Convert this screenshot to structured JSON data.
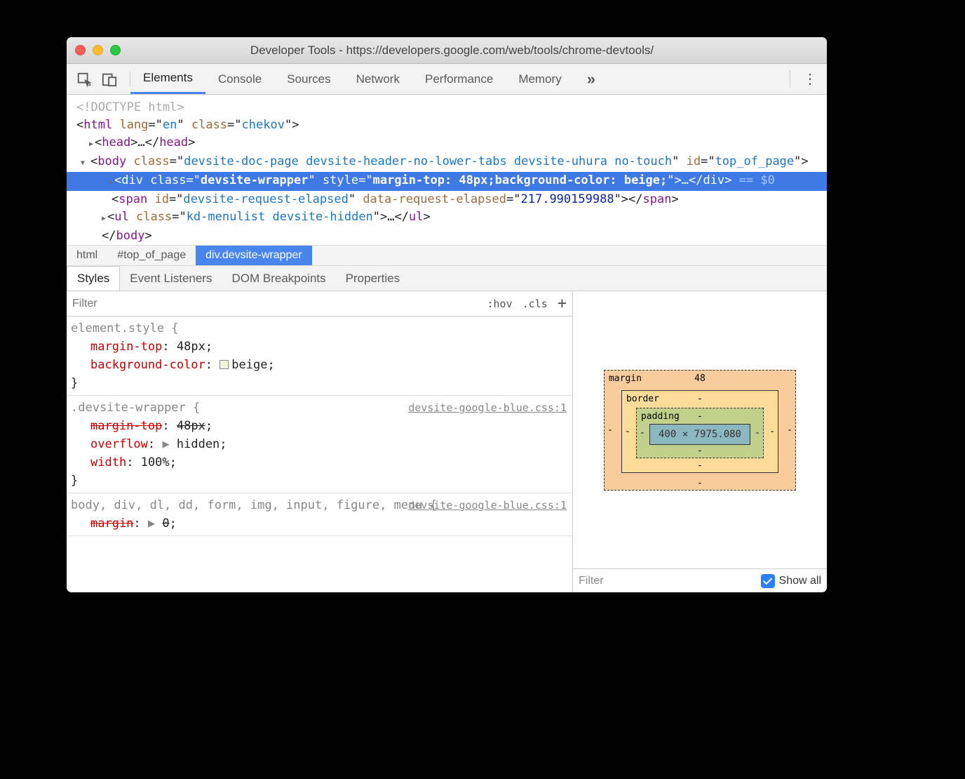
{
  "window_title": "Developer Tools - https://developers.google.com/web/tools/chrome-devtools/",
  "tabs": [
    "Elements",
    "Console",
    "Sources",
    "Network",
    "Performance",
    "Memory"
  ],
  "active_tab": "Elements",
  "dom": {
    "doctype": "<!DOCTYPE html>",
    "html_open": {
      "tag": "html",
      "lang": "en",
      "class": "chekov"
    },
    "head": {
      "tag": "head"
    },
    "body_open": {
      "tag": "body",
      "class": "devsite-doc-page devsite-header-no-lower-tabs devsite-uhura no-touch",
      "id": "top_of_page"
    },
    "selected": {
      "tag": "div",
      "class": "devsite-wrapper",
      "style": "margin-top: 48px;background-color: beige;",
      "eq": "== $0"
    },
    "span": {
      "tag": "span",
      "id": "devsite-request-elapsed",
      "attr": "data-request-elapsed",
      "attrval": "217.990159988"
    },
    "ul": {
      "tag": "ul",
      "class": "kd-menulist devsite-hidden"
    },
    "body_close": "</body>"
  },
  "breadcrumb": [
    "html",
    "#top_of_page",
    "div.devsite-wrapper"
  ],
  "subtabs": [
    "Styles",
    "Event Listeners",
    "DOM Breakpoints",
    "Properties"
  ],
  "active_subtab": "Styles",
  "filter_placeholder": "Filter",
  "hov": ":hov",
  "cls": ".cls",
  "rules": [
    {
      "selector": "element.style",
      "props": [
        {
          "k": "margin-top",
          "v": "48px"
        },
        {
          "k": "background-color",
          "v": "beige",
          "swatch": true
        }
      ]
    },
    {
      "selector": ".devsite-wrapper",
      "src": "devsite-google-blue.css:1",
      "props": [
        {
          "k": "margin-top",
          "v": "48px",
          "strike": true
        },
        {
          "k": "overflow",
          "v": "hidden",
          "tri": true
        },
        {
          "k": "width",
          "v": "100%"
        }
      ]
    },
    {
      "selector": "body, div, dl, dd, form, img, input, figure, menu",
      "src": "devsite-google-blue.css:1",
      "props": [
        {
          "k": "margin",
          "v": "0",
          "tri": true,
          "strike": true
        }
      ],
      "noclose": true
    }
  ],
  "boxmodel": {
    "margin_label": "margin",
    "margin_top": "48",
    "margin_sides": "-",
    "border_label": "border",
    "border_sides": "-",
    "padding_label": "padding",
    "padding_sides": "-",
    "content": "400 × 7975.080"
  },
  "computed_filter": "Filter",
  "show_all": "Show all"
}
